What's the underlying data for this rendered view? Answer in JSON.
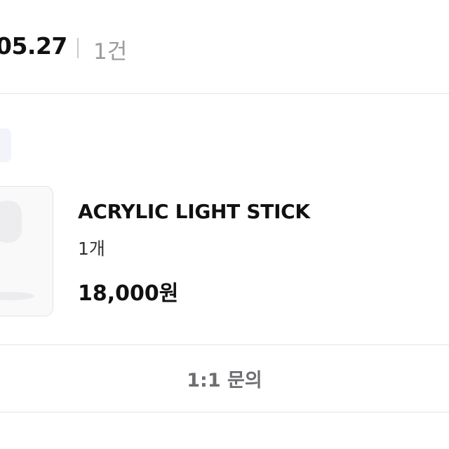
{
  "order": {
    "date": "05.27",
    "count": "1건"
  },
  "item": {
    "name": "ACRYLIC LIGHT STICK",
    "quantity": "1개",
    "price": "18,000원",
    "thumbnail_icon": "product-image"
  },
  "actions": {
    "inquiry_label": "1:1 문의"
  },
  "colors": {
    "text_primary": "#111111",
    "text_muted": "#9a9a9f",
    "divider": "#e6e6e9"
  }
}
